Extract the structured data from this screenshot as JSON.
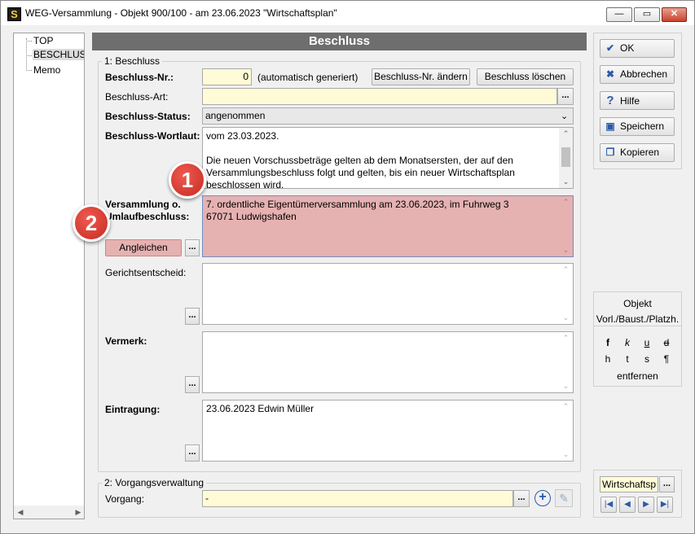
{
  "window": {
    "title": "WEG-Versammlung - Objekt 900/100 - am 23.06.2023 \"Wirtschaftsplan\"",
    "icon_letter": "S"
  },
  "tree": {
    "items": [
      "TOP",
      "BESCHLUSS",
      "Memo"
    ]
  },
  "banner": "Beschluss",
  "section1": {
    "legend": "1: Beschluss",
    "nr_label": "Beschluss-Nr.:",
    "nr_value": "0",
    "nr_note": "(automatisch generiert)",
    "nr_change_button": "Beschluss-Nr. ändern",
    "delete_button": "Beschluss löschen",
    "art_label": "Beschluss-Art:",
    "art_value": "",
    "status_label": "Beschluss-Status:",
    "status_value": "angenommen",
    "wortlaut_label": "Beschluss-Wortlaut:",
    "wortlaut_lines": [
      "vom 23.03.2023.",
      "",
      "Die neuen Vorschussbeträge gelten ab dem Monatsersten, der auf den",
      "Versammlungsbeschluss folgt und gelten, bis ein neuer Wirtschaftsplan",
      "beschlossen wird."
    ],
    "versammlung_label_1": "Versammlung o.",
    "versammlung_label_2": "Umlaufbeschluss:",
    "versammlung_lines": [
      "7. ordentliche Eigentümerversammlung am 23.06.2023, im Fuhrweg 3",
      "67071 Ludwigshafen"
    ],
    "angleichen_button": "Angleichen",
    "gericht_label": "Gerichtsentscheid:",
    "gericht_value": "",
    "vermerk_label": "Vermerk:",
    "vermerk_value": "",
    "eintragung_label": "Eintragung:",
    "eintragung_value": "23.06.2023 Edwin Müller",
    "dots": "..."
  },
  "section2": {
    "legend": "2: Vorgangsverwaltung",
    "vorgang_label": "Vorgang:",
    "vorgang_value": "-"
  },
  "badges": [
    "1",
    "2"
  ],
  "side": {
    "ok": "OK",
    "cancel": "Abbrechen",
    "help": "Hilfe",
    "save": "Speichern",
    "copy": "Kopieren",
    "objekt": "Objekt",
    "vorbau": "Vorl./Baust./Platzh.",
    "fmt_row1": [
      "f",
      "k",
      "u",
      "d"
    ],
    "fmt_row2": [
      "h",
      "t",
      "s",
      "¶"
    ],
    "remove": "entfernen",
    "nav_value": "Wirtschaftsp",
    "nav_buttons": [
      "|◀",
      "◀",
      "▶",
      "▶|"
    ]
  },
  "colors": {
    "banner": "#6e6e6e",
    "highlight": "#e8b0b0",
    "yellow": "#fffbd6",
    "badge": "#d9342b"
  }
}
